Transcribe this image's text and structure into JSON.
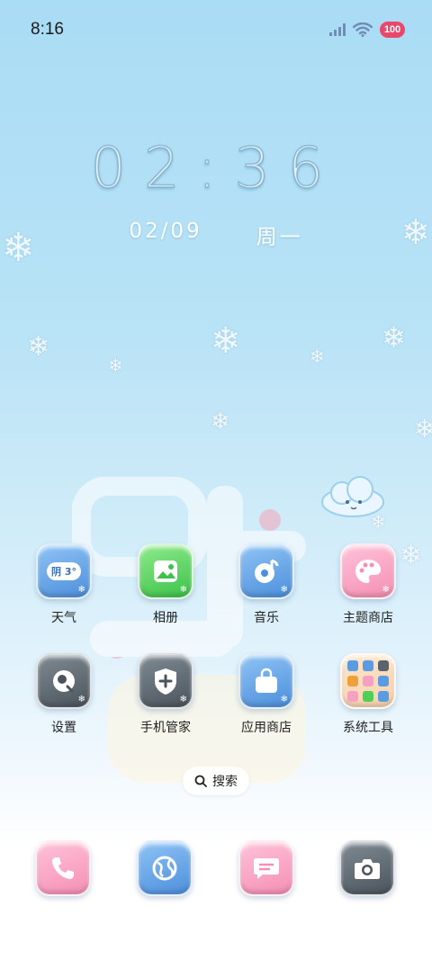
{
  "status_bar": {
    "time": "8:16",
    "battery": "100",
    "icons": [
      "signal-icon",
      "wifi-icon"
    ]
  },
  "clock": {
    "time": "02:36",
    "date": "02/09",
    "weekday": "周一"
  },
  "apps": [
    {
      "label": "天气",
      "icon": "weather-icon",
      "badge": "阴 3°"
    },
    {
      "label": "相册",
      "icon": "gallery-icon"
    },
    {
      "label": "音乐",
      "icon": "music-icon"
    },
    {
      "label": "主题商店",
      "icon": "palette-icon"
    },
    {
      "label": "设置",
      "icon": "settings-icon"
    },
    {
      "label": "手机管家",
      "icon": "shield-plus-icon"
    },
    {
      "label": "应用商店",
      "icon": "shopping-bag-icon"
    },
    {
      "label": "系统工具",
      "icon": "folder-icon"
    }
  ],
  "search": {
    "label": "搜索"
  },
  "dock": [
    {
      "icon": "phone-icon"
    },
    {
      "icon": "browser-icon"
    },
    {
      "icon": "messages-icon"
    },
    {
      "icon": "camera-icon"
    }
  ],
  "colors": {
    "tile_blue": "#5b9be2",
    "tile_green": "#4fcf57",
    "tile_pink": "#f7a1c2",
    "tile_gray": "#59636b",
    "battery": "#e9476c"
  }
}
